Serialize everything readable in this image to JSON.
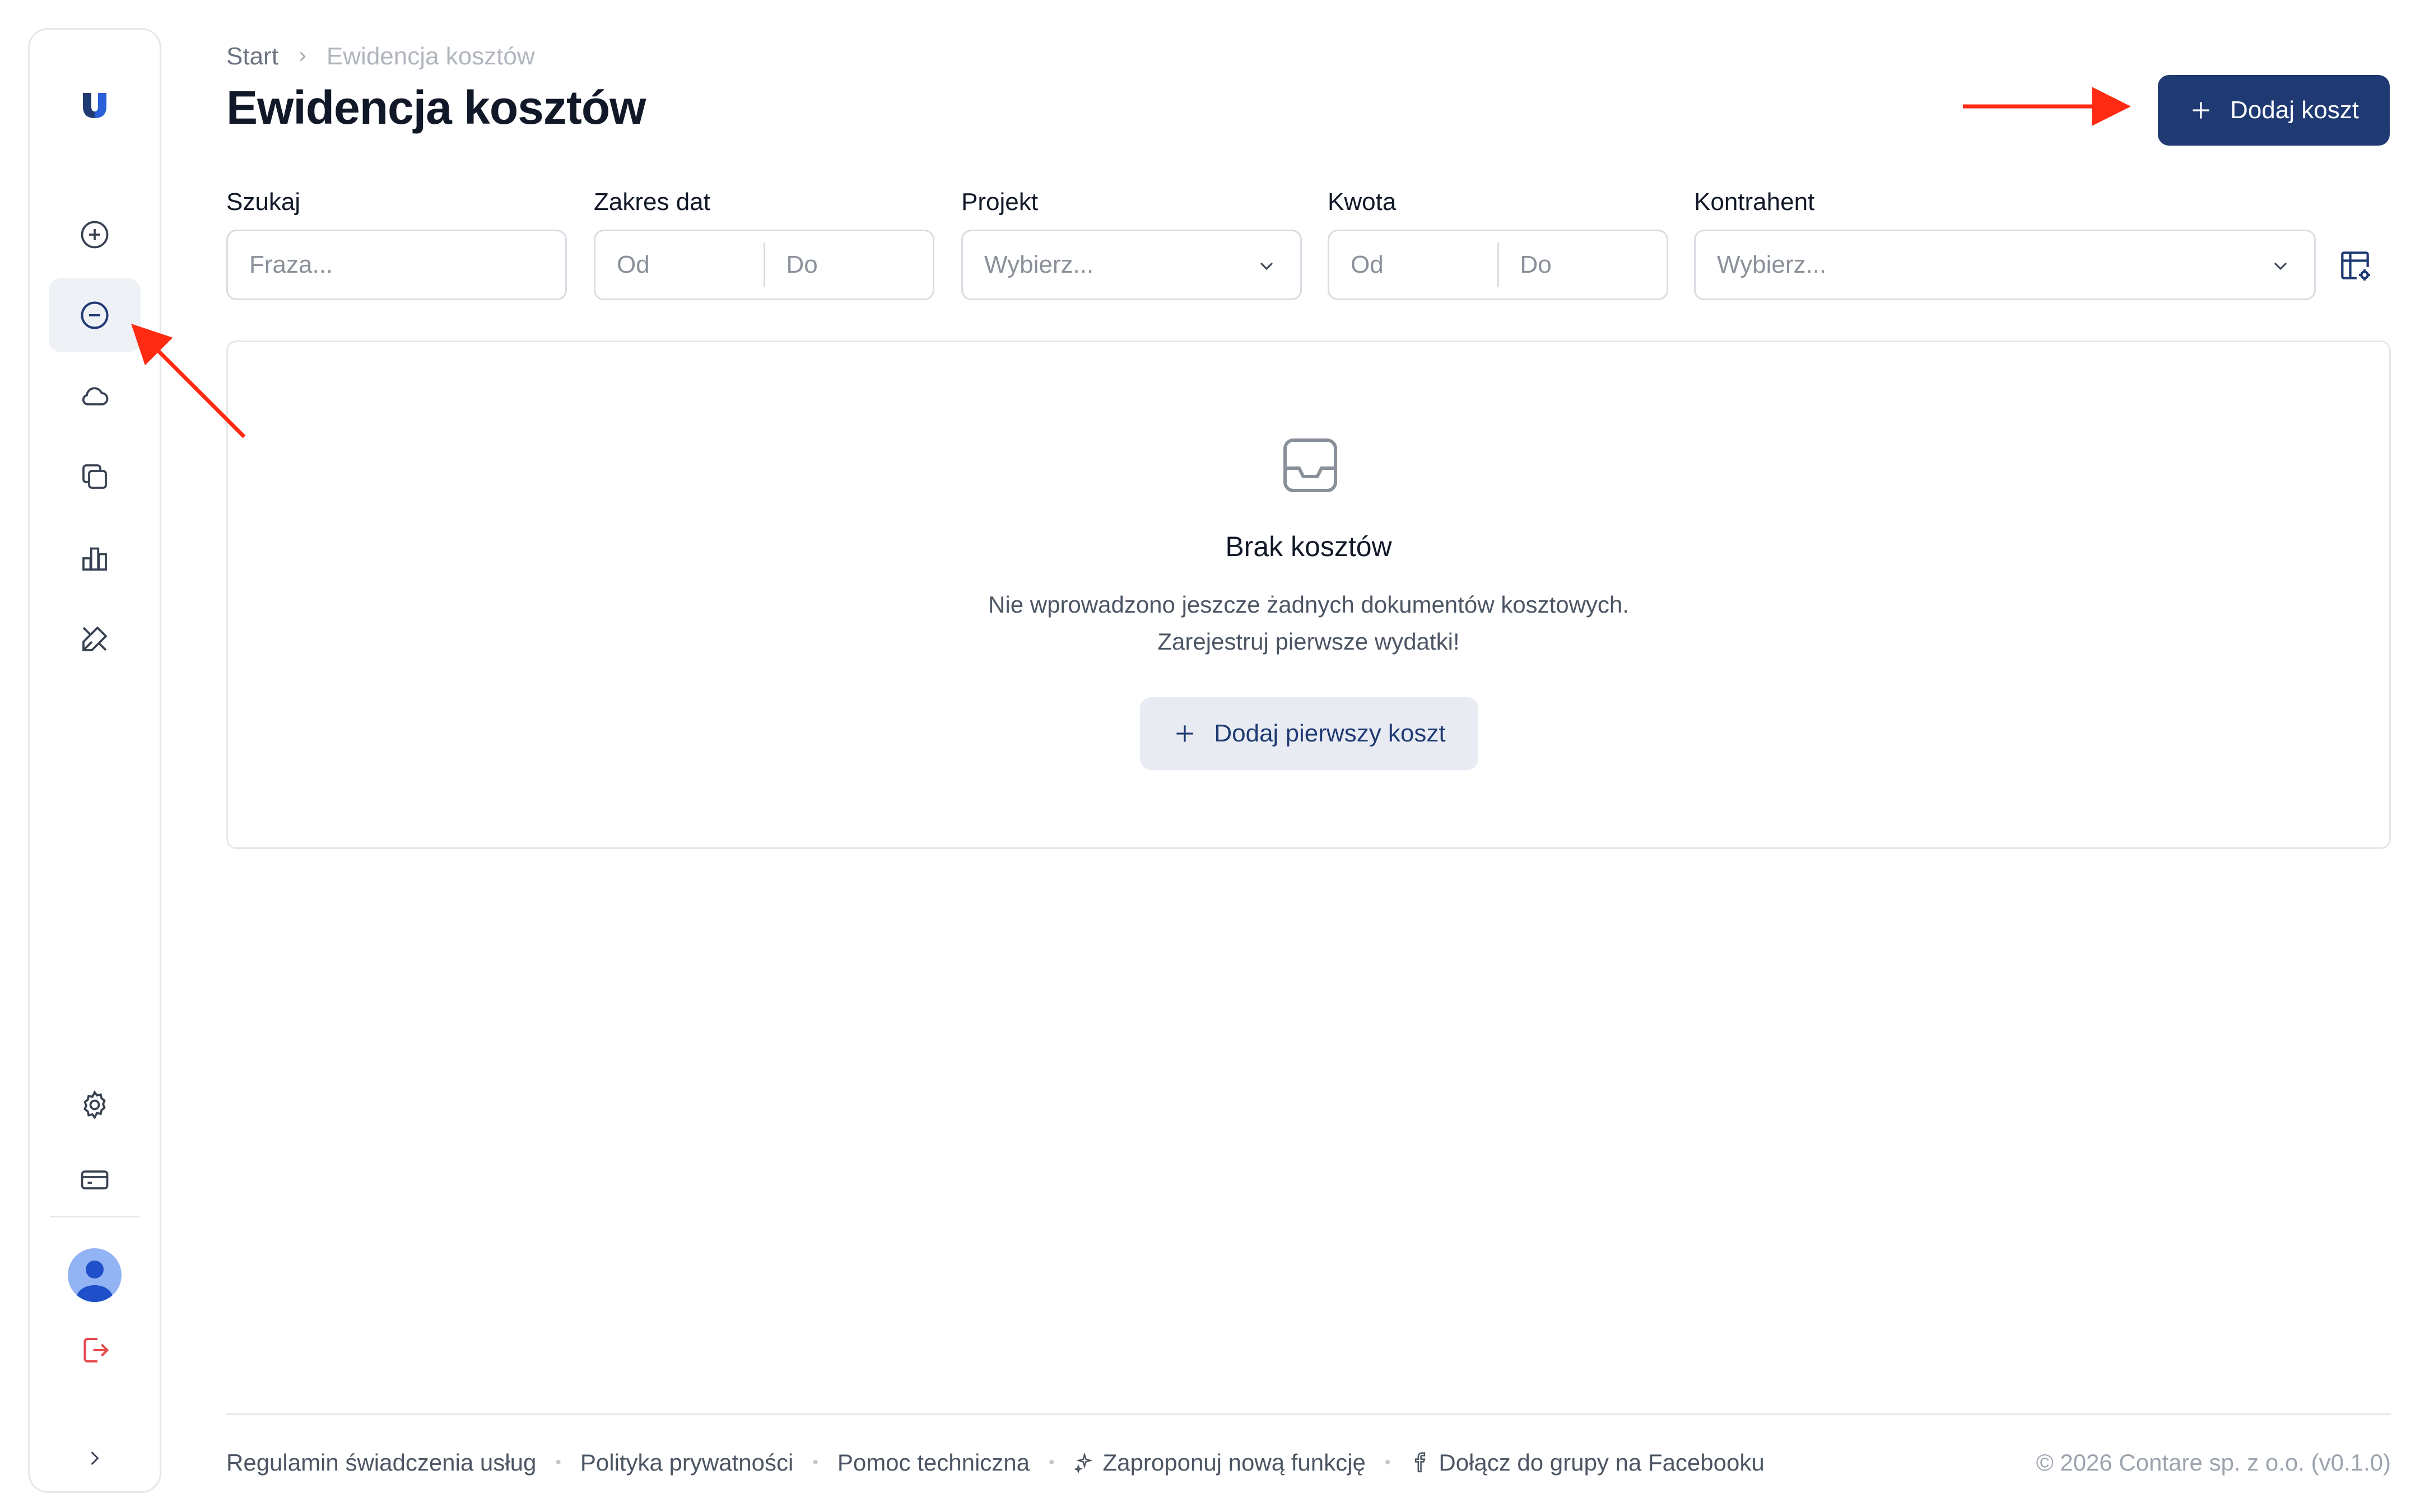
{
  "sidebar": {
    "items": [
      {
        "name": "add-income",
        "icon": "plus-circle-icon"
      },
      {
        "name": "costs",
        "icon": "minus-circle-icon",
        "active": true
      },
      {
        "name": "cloud",
        "icon": "cloud-icon"
      },
      {
        "name": "documents",
        "icon": "copy-icon"
      },
      {
        "name": "reports",
        "icon": "bar-chart-icon"
      },
      {
        "name": "tools",
        "icon": "tools-icon"
      },
      {
        "name": "settings",
        "icon": "gear-icon"
      },
      {
        "name": "billing",
        "icon": "card-icon"
      }
    ]
  },
  "breadcrumb": {
    "home": "Start",
    "current": "Ewidencja kosztów"
  },
  "header": {
    "title": "Ewidencja kosztów",
    "add_button": "Dodaj koszt"
  },
  "filters": {
    "search": {
      "label": "Szukaj",
      "placeholder": "Fraza..."
    },
    "date_range": {
      "label": "Zakres dat",
      "from": "Od",
      "to": "Do"
    },
    "project": {
      "label": "Projekt",
      "placeholder": "Wybierz..."
    },
    "amount": {
      "label": "Kwota",
      "from": "Od",
      "to": "Do"
    },
    "contractor": {
      "label": "Kontrahent",
      "placeholder": "Wybierz..."
    }
  },
  "empty_state": {
    "title": "Brak kosztów",
    "line1": "Nie wprowadzono jeszcze żadnych dokumentów kosztowych.",
    "line2": "Zarejestruj pierwsze wydatki!",
    "button": "Dodaj pierwszy koszt"
  },
  "footer": {
    "terms": "Regulamin świadczenia usług",
    "privacy": "Polityka prywatności",
    "support": "Pomoc techniczna",
    "suggest": "Zaproponuj nową funkcję",
    "facebook": "Dołącz do grupy na Facebooku",
    "copyright": "© 2026 Contare sp. z o.o. (v0.1.0)"
  },
  "colors": {
    "primary": "#1f3a73",
    "active_bg": "#eef1f6",
    "annotation_arrow": "#ff2a12",
    "logout": "#e5484d"
  }
}
